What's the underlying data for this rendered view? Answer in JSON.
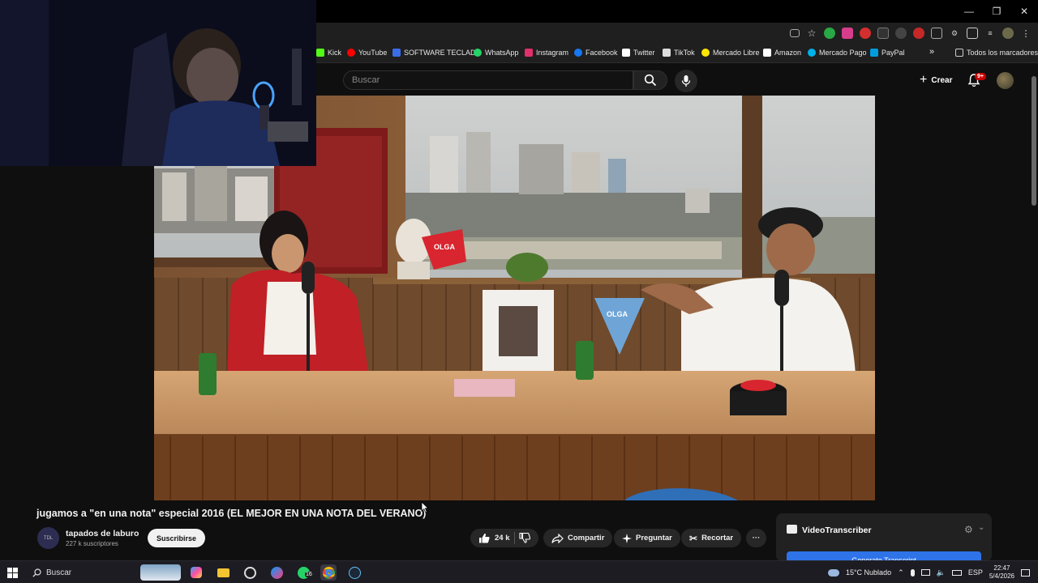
{
  "colors": {
    "accent": "#cc0000",
    "background": "#0f0f0f",
    "transcriber_button": "#2e73e8"
  },
  "bookmarks": [
    {
      "label": "Kick",
      "icon": "kick-icon",
      "color": "#53fc18"
    },
    {
      "label": "YouTube",
      "icon": "youtube-icon",
      "color": "#ff0000"
    },
    {
      "label": "SOFTWARE TECLADO",
      "icon": "keyboard-software-icon",
      "color": "#3a6ee8"
    },
    {
      "label": "WhatsApp",
      "icon": "whatsapp-icon",
      "color": "#25d366"
    },
    {
      "label": "Instagram",
      "icon": "instagram-icon",
      "color": "#e1306c"
    },
    {
      "label": "Facebook",
      "icon": "facebook-icon",
      "color": "#1877f2"
    },
    {
      "label": "Twitter",
      "icon": "x-icon",
      "color": "#ffffff"
    },
    {
      "label": "TikTok",
      "icon": "tiktok-icon",
      "color": "#ffffff"
    },
    {
      "label": "Mercado Libre",
      "icon": "mercadolibre-icon",
      "color": "#ffe600"
    },
    {
      "label": "Amazon",
      "icon": "amazon-icon",
      "color": "#ffffff"
    },
    {
      "label": "Mercado Pago",
      "icon": "mercadopago-icon",
      "color": "#00b1ea"
    },
    {
      "label": "PayPal",
      "icon": "paypal-icon",
      "color": "#009cde"
    }
  ],
  "bookmarks_overflow": "»",
  "all_bookmarks": "Todos los marcadores",
  "header": {
    "search_placeholder": "Buscar",
    "create_label": "Crear",
    "notifications_badge": "9+"
  },
  "video": {
    "title": "jugamos a \"en una nota\" especial 2016 (EL MEJOR EN UNA NOTA DEL VERANO)",
    "channel_name": "tapados de laburo",
    "channel_avatar_text": "TDL",
    "subscribers": "227 k suscriptores",
    "subscribe_label": "Suscribirse",
    "likes": "24 k",
    "share_label": "Compartir",
    "ask_label": "Preguntar",
    "clip_label": "Recortar",
    "more_label": "···"
  },
  "scene": {
    "flag_text": "OLGA",
    "banner_text": "OLGA"
  },
  "transcriber": {
    "title": "VideoTranscriber",
    "button_label": "Generate Transcript"
  },
  "taskbar": {
    "search_label": "Buscar",
    "chat_badge": "16",
    "weather": "15°C  Nublado",
    "language": "ESP",
    "time": "22:47",
    "date": "5/4/2026"
  }
}
